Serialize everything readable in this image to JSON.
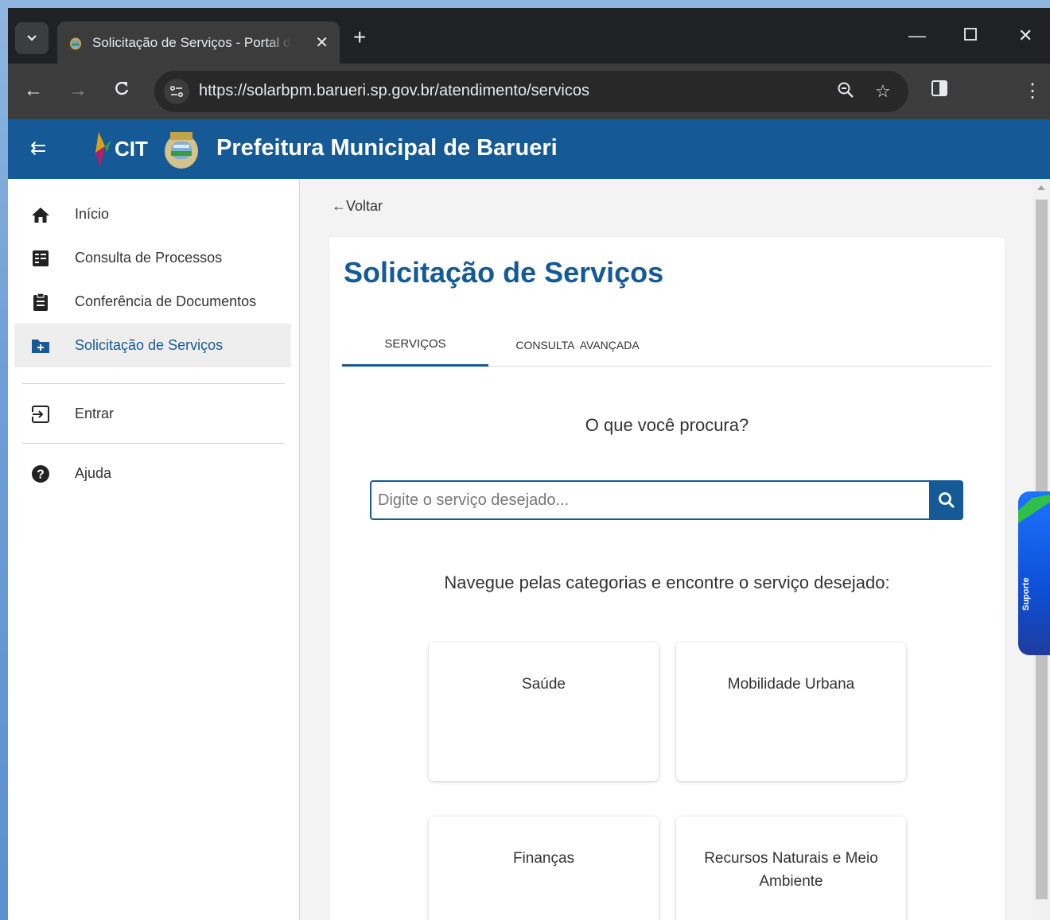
{
  "browser": {
    "tab_title": "Solicitação de Serviços - Portal de",
    "url": "https://solarbpm.barueri.sp.gov.br/atendimento/servicos",
    "new_tab_icon": "plus-icon",
    "close_icon": "close-icon"
  },
  "header": {
    "logo_text": "CIT",
    "title": "Prefeitura Municipal de Barueri"
  },
  "sidebar": {
    "items": [
      {
        "label": "Início",
        "icon": "home-icon"
      },
      {
        "label": "Consulta de Processos",
        "icon": "list-icon"
      },
      {
        "label": "Conferência de Documentos",
        "icon": "clipboard-icon"
      },
      {
        "label": "Solicitação de Serviços",
        "icon": "folder-plus-icon",
        "active": true
      },
      {
        "label": "Entrar",
        "icon": "login-icon"
      },
      {
        "label": "Ajuda",
        "icon": "help-icon"
      }
    ]
  },
  "main": {
    "back_label": "Voltar",
    "page_title": "Solicitação de Serviços",
    "tabs": [
      {
        "label": "SERVIÇOS",
        "active": true
      },
      {
        "label": "CONSULTA  AVANÇADA"
      }
    ],
    "prompt": "O que você procura?",
    "search": {
      "placeholder": "Digite o serviço desejado..."
    },
    "nav_hint": "Navegue pelas categorias e encontre o serviço desejado:",
    "categories": [
      {
        "label": "Saúde"
      },
      {
        "label": "Mobilidade Urbana"
      },
      {
        "label": "Finanças"
      },
      {
        "label": "Recursos Naturais e Meio Ambiente"
      }
    ]
  },
  "support": {
    "label": "Suporte"
  },
  "colors": {
    "brand": "#155a97",
    "support_blue": "#0c4fd6",
    "support_green": "#2fbf4a"
  }
}
